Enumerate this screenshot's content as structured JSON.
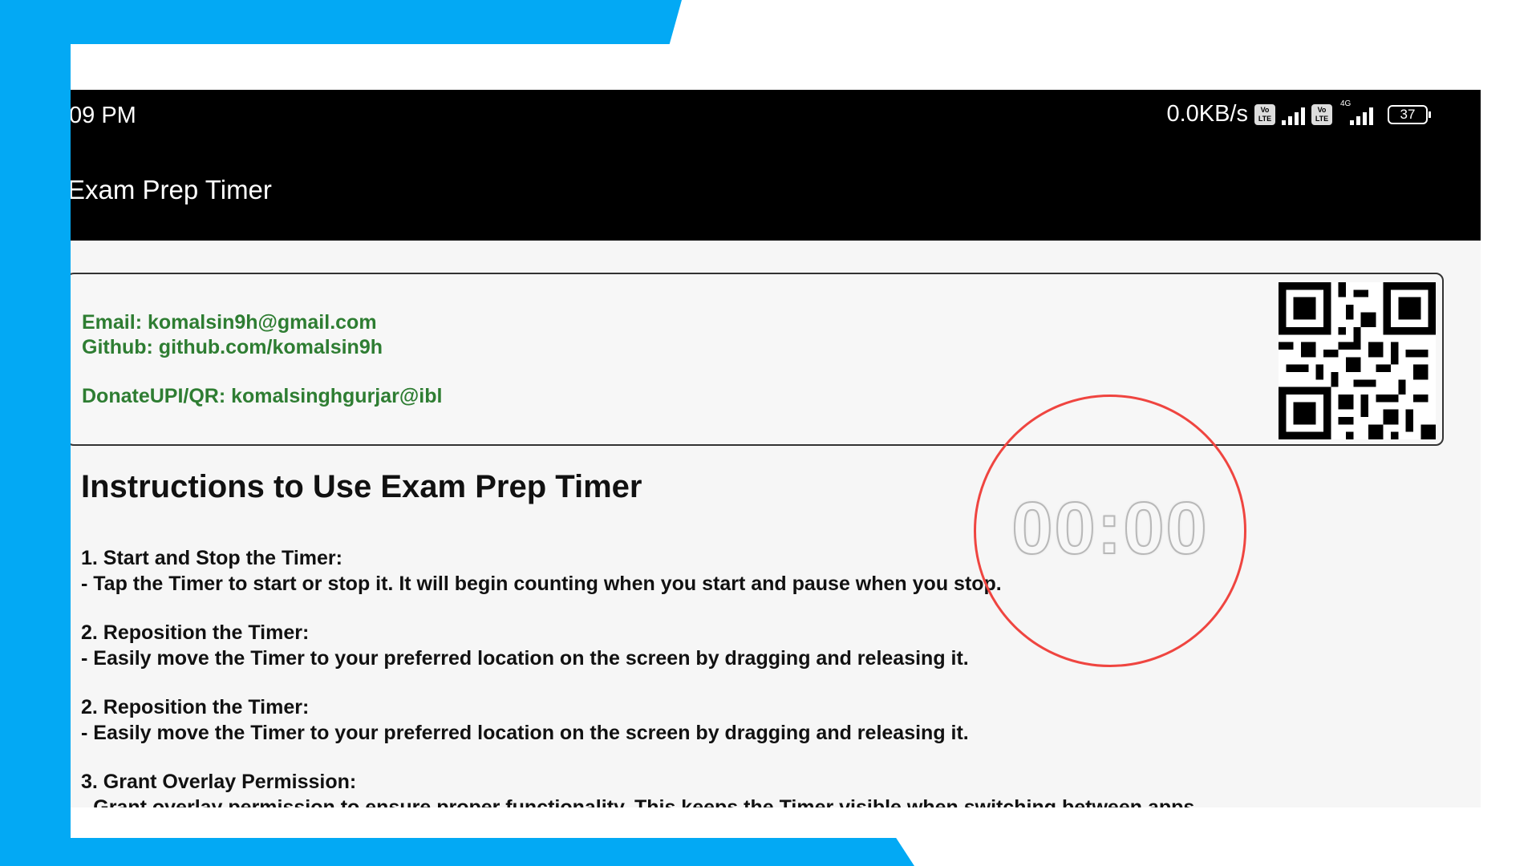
{
  "status_bar": {
    "time": "09 PM",
    "net_speed": "0.0KB/s",
    "volte_label": "Vo LTE",
    "network_type": "4G",
    "battery": "37"
  },
  "app": {
    "title": "Exam Prep Timer"
  },
  "contact": {
    "email": "Email: komalsin9h@gmail.com",
    "github": "Github: github.com/komalsin9h",
    "donate": "DonateUPI/QR: komalsinghgurjar@ibl"
  },
  "instructions": {
    "title": "Instructions to Use Exam Prep Timer",
    "lines": [
      "1. Start and Stop the Timer:",
      " - Tap the Timer to start or stop it. It will begin counting when you start and pause when you stop.",
      "2. Reposition the Timer:",
      " - Easily move the Timer to your preferred location on the screen by dragging and releasing it.",
      "2. Reposition the Timer:",
      " - Easily move the Timer to your preferred location on the screen by dragging and releasing it.",
      "3. Grant Overlay Permission:",
      " - Grant overlay permission to ensure proper functionality. This keeps the Timer visible when switching between apps."
    ]
  },
  "timer": {
    "display": "00:00"
  },
  "colors": {
    "frame_blue": "#03a9f4",
    "header_black": "#000000",
    "contact_green": "#2e7d32",
    "timer_ring_red": "#ef4540"
  },
  "icons": [
    "volte-icon",
    "signal-icon",
    "battery-icon",
    "qr-code-icon"
  ]
}
